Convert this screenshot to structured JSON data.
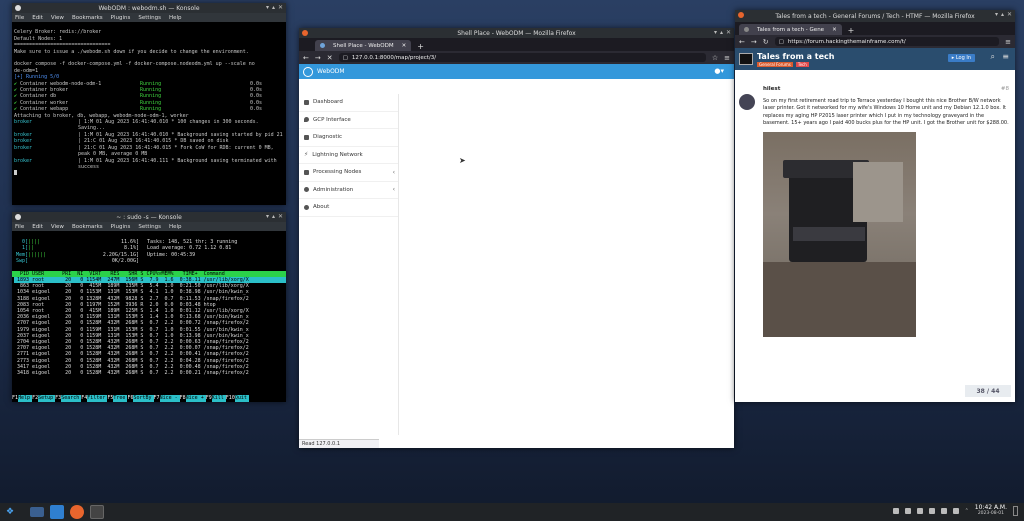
{
  "konsole_top": {
    "title": "WebODM : webodm.sh — Konsole",
    "menu": [
      "File",
      "Edit",
      "View",
      "Bookmarks",
      "Plugins",
      "Settings",
      "Help"
    ],
    "lines": [
      "Celery Broker: redis://broker",
      "Default Nodes: 1",
      "================================",
      "Make sure to issue a ./webodm.sh down if you decide to change the environment.",
      "",
      "docker compose -f docker-compose.yml -f docker-compose.nodeodm.yml up --scale no",
      "de-odm=1",
      "[+] Running 5/0"
    ],
    "containers": [
      {
        "name": "Container webodm-node-odm-1",
        "status": "Running",
        "time": "0.0s"
      },
      {
        "name": "Container broker",
        "status": "Running",
        "time": "0.0s"
      },
      {
        "name": "Container db",
        "status": "Running",
        "time": "0.0s"
      },
      {
        "name": "Container worker",
        "status": "Running",
        "time": "0.0s"
      },
      {
        "name": "Container webapp",
        "status": "Running",
        "time": "0.0s"
      }
    ],
    "attach_line": "Attaching to broker, db, webapp, webodm-node-odm-1, worker",
    "logs": [
      {
        "src": "broker",
        "msg": "| 1:M 01 Aug 2023 16:41:40.010 * 100 changes in 300 seconds. Saving..."
      },
      {
        "src": "broker",
        "msg": "| 1:M 01 Aug 2023 16:41:40.010 * Background saving started by pid 21"
      },
      {
        "src": "broker",
        "msg": "| 21:C 01 Aug 2023 16:41:40.015 * DB saved on disk"
      },
      {
        "src": "broker",
        "msg": "| 21:C 01 Aug 2023 16:41:40.015 * Fork CoW for RDB: current 0 MB, peak 0 MB, average 0 MB"
      },
      {
        "src": "broker",
        "msg": "| 1:M 01 Aug 2023 16:41:40.111 * Background saving terminated with success"
      }
    ]
  },
  "konsole_bottom": {
    "title": "~ : sudo -s — Konsole",
    "menu": [
      "File",
      "Edit",
      "View",
      "Bookmarks",
      "Plugins",
      "Settings",
      "Help"
    ],
    "meters": [
      {
        "label": "0[",
        "value": "11.6%]"
      },
      {
        "label": "1[",
        "value": "8.1%]"
      },
      {
        "label": "Mem[",
        "value": "2.20G/15.1G]"
      },
      {
        "label": "Swp[",
        "value": "0K/2.00G]"
      }
    ],
    "stats": [
      "Tasks: 148, 521 thr; 3 running",
      "Load average: 0.72 1.12 0.81",
      "Uptime: 00:45:39"
    ],
    "header": "  PID USER      PRI  NI  VIRT   RES   SHR S CPU%▽MEM%   TIME+  Command",
    "rows": [
      " 1893 root       20   0 1154M  247M  156M S  7.9  1.6  0:38.11 /usr/lib/xorg/X",
      "  863 root       20   0  415M  189M  135M S  5.4  1.0  0:21.50 /usr/lib/xorg/X",
      " 1034 eigoel     20   0 1153M  131M  153M S  4.1  1.0  0:38.98 /usr/bin/kwin_x",
      " 3188 eigoel     20   0 1328M  432M  9828 S  2.7  0.7  0:11.53 /snap/firefox/2",
      " 2083 root       20   0 1197M  152M  3936 R  2.0  0.0  0:03.48 htop",
      " 1054 root       20   0  415M  189M  125M S  1.4  1.0  0:01.12 /usr/lib/xorg/X",
      " 2036 eigoel     20   0 1159M  131M  153M S  1.4  1.0  0:13.68 /usr/bin/kwin_x",
      " 2707 eigoel     20   0 1528M  432M  268M S  0.7  2.2  0:00.72 /snap/firefox/2",
      " 1979 eigoel     20   0 1159M  131M  153M S  0.7  1.0  0:01.55 /usr/bin/kwin_x",
      " 2037 eigoel     20   0 1159M  131M  153M S  0.7  1.0  0:13.98 /usr/bin/kwin_x",
      " 2704 eigoel     20   0 1528M  432M  268M S  0.7  2.2  0:00.63 /snap/firefox/2",
      " 2707 eigoel     20   0 1528M  432M  268M S  0.7  2.2  0:00.07 /snap/firefox/2",
      " 2771 eigoel     20   0 1528M  432M  268M S  0.7  2.2  0:00.41 /snap/firefox/2",
      " 2773 eigoel     20   0 1528M  432M  268M S  0.7  2.2  0:04.28 /snap/firefox/2",
      " 3417 eigoel     20   0 1528M  432M  268M S  0.7  2.2  0:00.48 /snap/firefox/2",
      " 3418 eigoel     20   0 1528M  432M  268M S  0.7  2.2  0:00.21 /snap/firefox/2"
    ],
    "fkeys": [
      {
        "k": "F1",
        "v": "Help"
      },
      {
        "k": "F2",
        "v": "Setup"
      },
      {
        "k": "F3",
        "v": "Search"
      },
      {
        "k": "F4",
        "v": "Filter"
      },
      {
        "k": "F5",
        "v": "Tree"
      },
      {
        "k": "F6",
        "v": "SortBy"
      },
      {
        "k": "F7",
        "v": "Nice -"
      },
      {
        "k": "F8",
        "v": "Nice +"
      },
      {
        "k": "F9",
        "v": "Kill"
      },
      {
        "k": "F10",
        "v": "Quit"
      }
    ]
  },
  "firefox_center": {
    "title": "Shell Place - WebODM — Mozilla Firefox",
    "tab_label": "Shell Place - WebODM",
    "url": "127.0.0.1:8000/map/project/3/",
    "brand": "WebODM",
    "sidebar": [
      {
        "label": "Dashboard",
        "icon": "dashboard-icon",
        "arrow": false
      },
      {
        "label": "GCP Interface",
        "icon": "map-marker-icon",
        "arrow": false
      },
      {
        "label": "Diagnostic",
        "icon": "wrench-icon",
        "arrow": false
      },
      {
        "label": "Lightning Network",
        "icon": "bolt-icon",
        "arrow": false
      },
      {
        "label": "Processing Nodes",
        "icon": "wrench-icon",
        "arrow": true
      },
      {
        "label": "Administration",
        "icon": "gear-icon",
        "arrow": true
      },
      {
        "label": "About",
        "icon": "info-icon",
        "arrow": false
      }
    ],
    "status": "Read 127.0.0.1",
    "colors": {
      "accent": "#3498db"
    }
  },
  "firefox_right": {
    "title": "Tales from a tech - General Forums / Tech - HTMF — Mozilla Firefox",
    "tab_label": "Tales from a tech - Gene",
    "url": "https://forum.hackingthemainframe.com/t/",
    "topic_title": "Tales from a tech",
    "tags": [
      "General Forums",
      "Tech"
    ],
    "login": "Log In",
    "author": "hilest",
    "post_num": "#8",
    "post_text": "So on my first retirement road trip to Terrace yesterday I bought this nice Brother B/W network laser printer. Got it networked for my wife's Windows 10 Home unit and my Debian 12.1.0 box. It replaces my aging HP P2015 laser printer which I put in my technology graveyard in the basement. 15+ years ago I paid 400 bucks plus for the HP unit. I got the Brother unit for $288.00.",
    "pager": "38 / 44"
  },
  "taskbar": {
    "time": "10:42 A.M.",
    "date": "2023-08-01"
  }
}
